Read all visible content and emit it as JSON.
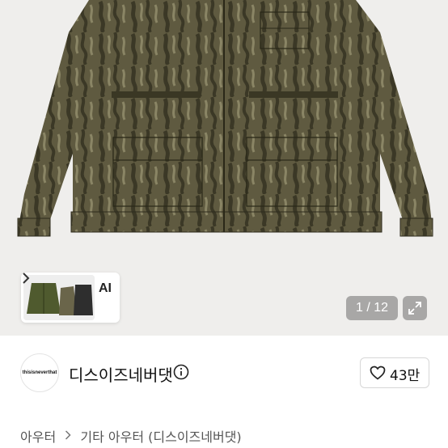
{
  "product": {
    "image_description_icon": "camo-jacket-photo",
    "ai_label": "AI",
    "pager": {
      "current": 1,
      "total": 12,
      "text": "1 / 12"
    }
  },
  "shop": {
    "avatar_text": "thisisneverthat",
    "name": "디스이즈네버댓",
    "likes": "43만"
  },
  "breadcrumb": {
    "items": [
      "아우터",
      "기타 아우터",
      "(디스이즈네버댓)"
    ]
  },
  "colors": {
    "camo_base": "#5f5a40",
    "camo_dark": "#3b3826",
    "camo_light": "#8a8565",
    "hero_bg": "#efeeec"
  }
}
